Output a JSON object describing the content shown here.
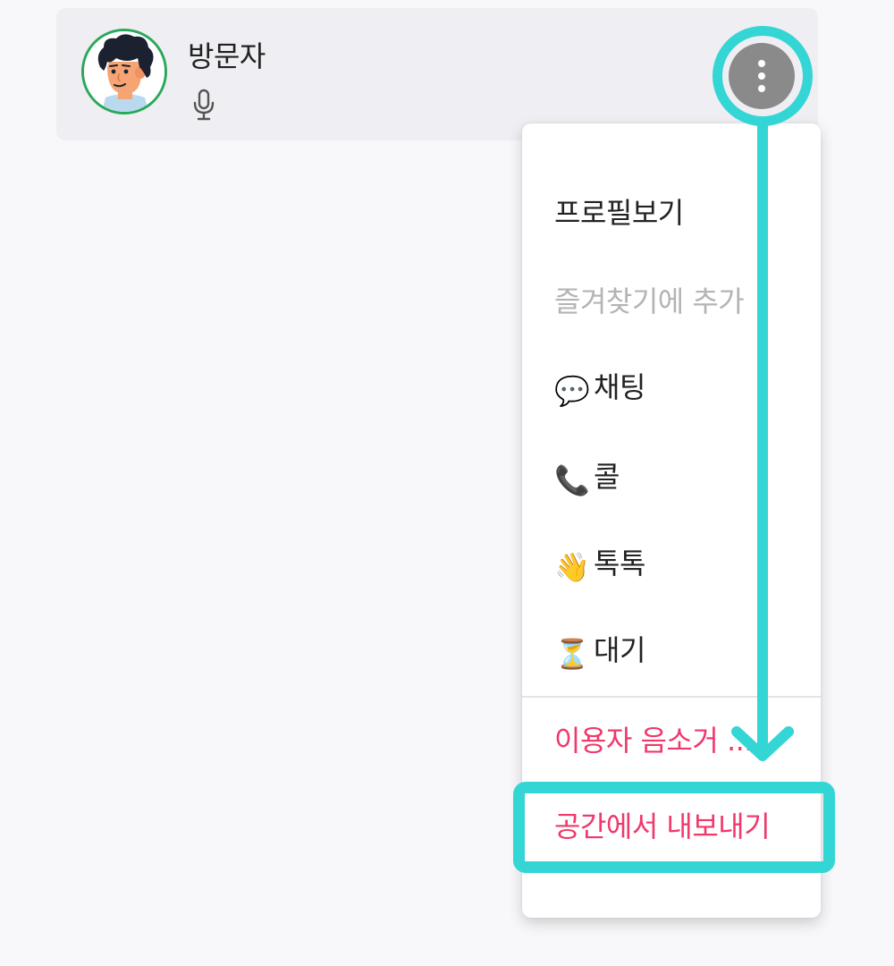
{
  "user": {
    "name": "방문자",
    "avatar_icon": "cartoon-avatar-icon",
    "status_icon": "microphone-icon",
    "ring_color": "#2aa85a"
  },
  "more_button": {
    "icon": "kebab-vertical-icon"
  },
  "menu": {
    "items": [
      {
        "label": "프로필보기",
        "style": "default"
      },
      {
        "label": "즐겨찾기에 추가",
        "style": "disabled"
      },
      {
        "label": "채팅",
        "icon": "speech-bubble-icon",
        "emoji": "💬",
        "style": "default"
      },
      {
        "label": "콜",
        "icon": "phone-icon",
        "emoji": "📞",
        "style": "default"
      },
      {
        "label": "톡톡",
        "icon": "waving-hand-icon",
        "emoji": "👋",
        "style": "default"
      },
      {
        "label": "대기",
        "icon": "hourglass-icon",
        "emoji": "⏳",
        "style": "default"
      }
    ],
    "danger_items": [
      {
        "label": "이용자 음소거 ..."
      },
      {
        "label": "공간에서 내보내기"
      }
    ]
  },
  "colors": {
    "highlight": "#33d6d5",
    "danger": "#f0386b",
    "disabled": "#b4b4b4"
  }
}
